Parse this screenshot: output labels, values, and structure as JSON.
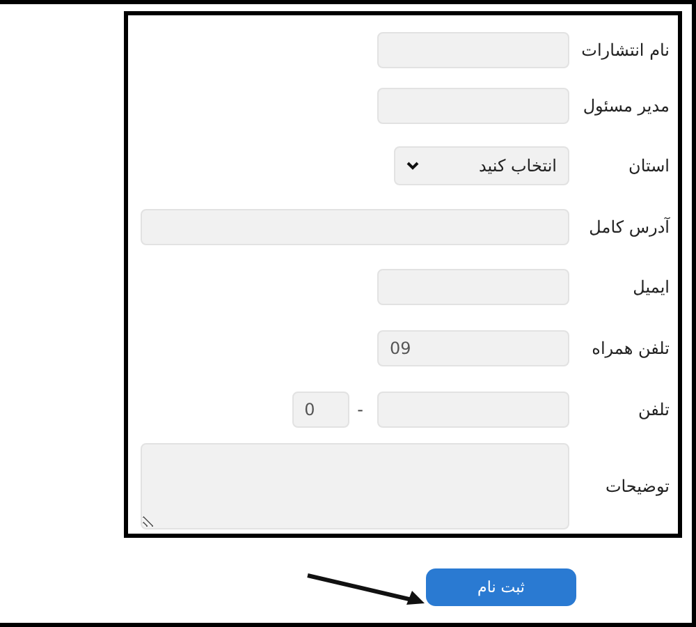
{
  "form": {
    "fields": [
      {
        "kind": "text",
        "label": "نام انتشارات"
      },
      {
        "kind": "text",
        "label": "مدیر مسئول"
      },
      {
        "kind": "select",
        "label": "استان",
        "value": "انتخاب کنید"
      },
      {
        "kind": "wide",
        "label": "آدرس کامل"
      },
      {
        "kind": "text",
        "label": "ایمیل"
      },
      {
        "kind": "text",
        "label": "تلفن همراه",
        "value": "09"
      },
      {
        "kind": "phone",
        "label": "تلفن",
        "separator": "-",
        "code": "0"
      },
      {
        "kind": "textarea",
        "label": "توضیحات"
      }
    ]
  },
  "submit_button": "ثبت نام"
}
